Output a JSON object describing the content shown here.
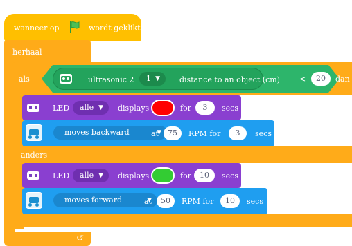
{
  "hat": {
    "text_before": "wanneer op",
    "text_after": "wordt geklikt"
  },
  "loop": {
    "label": "herhaal"
  },
  "if_block": {
    "label": "als",
    "sensor": "ultrasonic 2",
    "port": "1",
    "measure": "distance to an object (cm)",
    "operator": "<",
    "threshold": "20",
    "then_label": "dan",
    "else_label": "anders"
  },
  "led1": {
    "label": "LED",
    "target": "alle",
    "displays": "displays",
    "color": "#ff0000",
    "for": "for",
    "secs_value": "3",
    "secs": "secs"
  },
  "motor1": {
    "direction": "moves backward",
    "at": "at",
    "rpm": "75",
    "rpm_label": "RPM for",
    "secs_value": "3",
    "secs": "secs"
  },
  "led2": {
    "label": "LED",
    "target": "alle",
    "displays": "displays",
    "color": "#33cc33",
    "for": "for",
    "secs_value": "10",
    "secs": "secs"
  },
  "motor2": {
    "direction": "moves forward",
    "at": "at",
    "rpm": "50",
    "rpm_label": "RPM for",
    "secs_value": "10",
    "secs": "secs"
  },
  "loop_arrow_icon": "loop-arrow-icon",
  "colors": {
    "events": "#ffbf00",
    "control": "#ffab19",
    "sensor": "#2db56b",
    "led": "#8a3fd0",
    "motor": "#1f9ef0"
  }
}
